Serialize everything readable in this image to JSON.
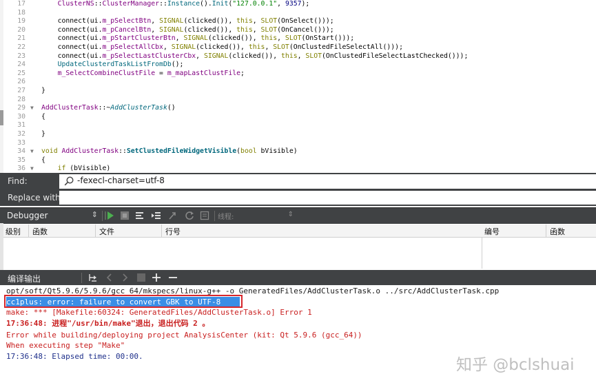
{
  "editor": {
    "lines": [
      {
        "n": "17",
        "fold": "",
        "segs": [
          [
            "    ",
            ""
          ],
          [
            "ClusterNS",
            "ty"
          ],
          [
            "::",
            ""
          ],
          [
            "ClusterManager",
            "ty"
          ],
          [
            "::",
            ""
          ],
          [
            "Instance",
            "fn"
          ],
          [
            "().",
            ""
          ],
          [
            "Init",
            "fn"
          ],
          [
            "(",
            ""
          ],
          [
            "\"127.0.0.1\"",
            "st"
          ],
          [
            ", ",
            ""
          ],
          [
            "9357",
            "nm"
          ],
          [
            ");",
            ""
          ]
        ]
      },
      {
        "n": "18",
        "fold": "",
        "segs": []
      },
      {
        "n": "19",
        "fold": "",
        "segs": [
          [
            "    connect(ui.",
            ""
          ],
          [
            "m_pSelectBtn",
            "ma"
          ],
          [
            ", ",
            ""
          ],
          [
            "SIGNAL",
            "kw"
          ],
          [
            "(clicked()), ",
            ""
          ],
          [
            "this",
            "kw"
          ],
          [
            ", ",
            ""
          ],
          [
            "SLOT",
            "kw"
          ],
          [
            "(OnSelect()));",
            ""
          ]
        ]
      },
      {
        "n": "20",
        "fold": "",
        "segs": [
          [
            "    connect(ui.",
            ""
          ],
          [
            "m_pCancelBtn",
            "ma"
          ],
          [
            ", ",
            ""
          ],
          [
            "SIGNAL",
            "kw"
          ],
          [
            "(clicked()), ",
            ""
          ],
          [
            "this",
            "kw"
          ],
          [
            ", ",
            ""
          ],
          [
            "SLOT",
            "kw"
          ],
          [
            "(OnCancel()));",
            ""
          ]
        ]
      },
      {
        "n": "21",
        "fold": "",
        "segs": [
          [
            "    connect(ui.",
            ""
          ],
          [
            "m_pStartClusterBtn",
            "ma"
          ],
          [
            ", ",
            ""
          ],
          [
            "SIGNAL",
            "kw"
          ],
          [
            "(clicked()), ",
            ""
          ],
          [
            "this",
            "kw"
          ],
          [
            ", ",
            ""
          ],
          [
            "SLOT",
            "kw"
          ],
          [
            "(OnStart()));",
            ""
          ]
        ]
      },
      {
        "n": "22",
        "fold": "",
        "segs": [
          [
            "    connect(ui.",
            ""
          ],
          [
            "m_pSelectAllCbx",
            "ma"
          ],
          [
            ", ",
            ""
          ],
          [
            "SIGNAL",
            "kw"
          ],
          [
            "(clicked()), ",
            ""
          ],
          [
            "this",
            "kw"
          ],
          [
            ", ",
            ""
          ],
          [
            "SLOT",
            "kw"
          ],
          [
            "(OnClustedFileSelectAll()));",
            ""
          ]
        ]
      },
      {
        "n": "23",
        "fold": "",
        "segs": [
          [
            "    connect(ui.",
            ""
          ],
          [
            "m_pSelectLastClusterCbx",
            "ma"
          ],
          [
            ", ",
            ""
          ],
          [
            "SIGNAL",
            "kw"
          ],
          [
            "(clicked()), ",
            ""
          ],
          [
            "this",
            "kw"
          ],
          [
            ", ",
            ""
          ],
          [
            "SLOT",
            "kw"
          ],
          [
            "(OnClustedFileSelectLastChecked()));",
            ""
          ]
        ]
      },
      {
        "n": "24",
        "fold": "",
        "segs": [
          [
            "    ",
            ""
          ],
          [
            "UpdateClusterdTaskListFromDb",
            "fn"
          ],
          [
            "();",
            ""
          ]
        ]
      },
      {
        "n": "25",
        "fold": "",
        "segs": [
          [
            "    ",
            ""
          ],
          [
            "m_SelectCombineClustFile",
            "ma"
          ],
          [
            " = ",
            ""
          ],
          [
            "m_mapLastClustFile",
            "ma"
          ],
          [
            ";",
            ""
          ]
        ]
      },
      {
        "n": "26",
        "fold": "",
        "segs": []
      },
      {
        "n": "27",
        "fold": "",
        "segs": [
          [
            "}",
            ""
          ]
        ]
      },
      {
        "n": "28",
        "fold": "",
        "segs": []
      },
      {
        "n": "29",
        "fold": "▼",
        "segs": [
          [
            "AddClusterTask",
            "ty"
          ],
          [
            "::~",
            ""
          ],
          [
            "AddClusterTask",
            "it"
          ],
          [
            "()",
            ""
          ]
        ]
      },
      {
        "n": "30",
        "fold": "",
        "segs": [
          [
            "{",
            ""
          ]
        ]
      },
      {
        "n": "31",
        "fold": "",
        "segs": []
      },
      {
        "n": "32",
        "fold": "",
        "segs": [
          [
            "}",
            ""
          ]
        ]
      },
      {
        "n": "33",
        "fold": "",
        "segs": []
      },
      {
        "n": "34",
        "fold": "▼",
        "segs": [
          [
            "void",
            "kw"
          ],
          [
            " ",
            ""
          ],
          [
            "AddClusterTask",
            "ty"
          ],
          [
            "::",
            ""
          ],
          [
            "SetClustedFileWidgetVisible",
            "bf"
          ],
          [
            "(",
            ""
          ],
          [
            "bool",
            "kw"
          ],
          [
            " bVisible)",
            ""
          ]
        ]
      },
      {
        "n": "35",
        "fold": "",
        "segs": [
          [
            "{",
            ""
          ]
        ]
      },
      {
        "n": "36",
        "fold": "▼",
        "segs": [
          [
            "    ",
            ""
          ],
          [
            "if",
            "kw"
          ],
          [
            " (bVisible)",
            ""
          ]
        ]
      }
    ]
  },
  "find": {
    "find_label": "Find:",
    "find_value": "-fexecl-charset=utf-8",
    "replace_label": "Replace with:",
    "replace_value": ""
  },
  "debugger": {
    "title": "Debugger",
    "thread_label": "线程:",
    "stack_columns": [
      "级别",
      "函数",
      "文件",
      "行号"
    ],
    "register_columns": [
      "编号",
      "函数"
    ]
  },
  "compile": {
    "title": "编译输出",
    "lines": [
      {
        "text": "opt/soft/Qt5.9.6/5.9.6/gcc_64/mkspecs/linux-g++ -o GeneratedFiles/AddClusterTask.o ../src/AddClusterTask.cpp",
        "color": "#1a1a1a",
        "bold": false
      },
      {
        "text": "cc1plus: error: failure to convert GBK to UTF-8",
        "color": "#ffffff",
        "bold": false
      },
      {
        "text": "make: *** [Makefile:60324: GeneratedFiles/AddClusterTask.o] Error 1",
        "color": "#c81e1e",
        "bold": false
      },
      {
        "text": "17:36:48: 进程\"/usr/bin/make\"退出，退出代码 2 。",
        "color": "#c81e1e",
        "bold": true
      },
      {
        "text": "Error while building/deploying project AnalysisCenter (kit: Qt 5.9.6 (gcc_64))",
        "color": "#c81e1e",
        "bold": false
      },
      {
        "text": "When executing step \"Make\"",
        "color": "#c81e1e",
        "bold": false
      },
      {
        "text": "17:36:48: Elapsed time: 00:00.",
        "color": "#1e2f8a",
        "bold": false
      }
    ]
  },
  "watermark": "知乎 @bclshuai",
  "colors": {
    "panel": "#404244",
    "error": "#c81e1e",
    "selection": "#3a8ee6",
    "callout": "#d6262b"
  }
}
